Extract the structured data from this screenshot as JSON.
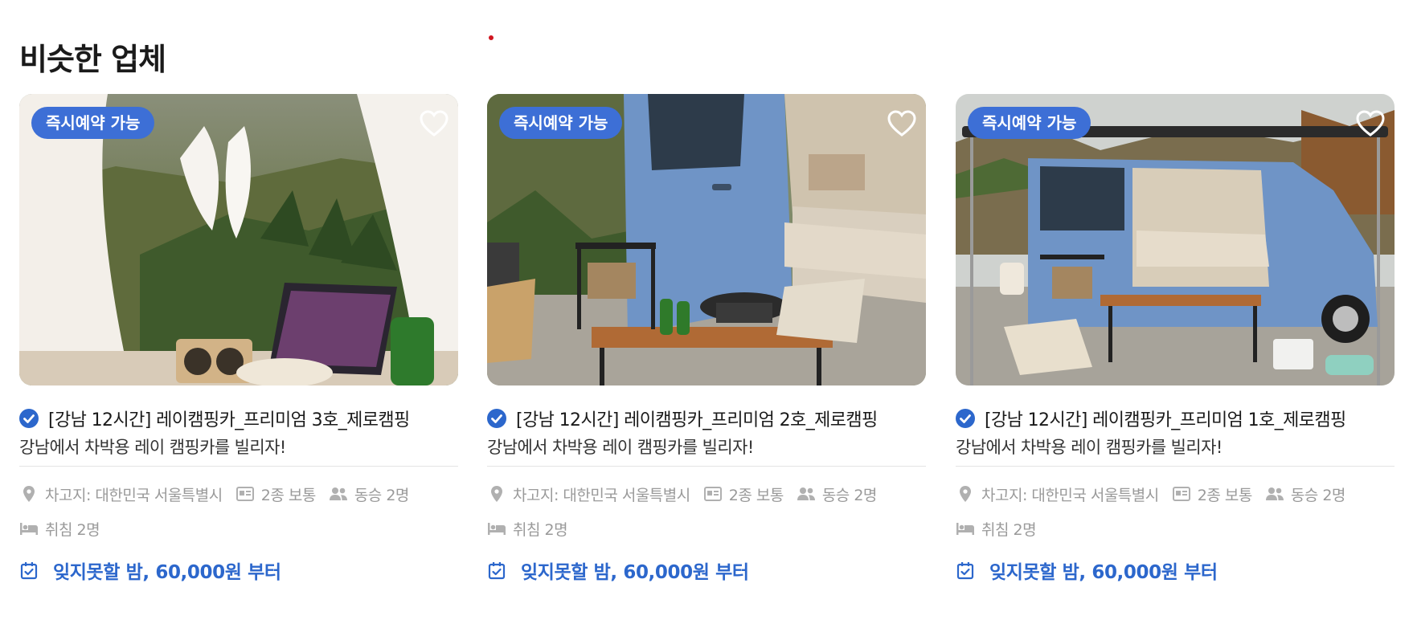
{
  "section": {
    "title": "비슷한 업체"
  },
  "cards": [
    {
      "badge": "즉시예약 가능",
      "name": "[강남 12시간] 레이캠핑카_프리미엄 3호_제로캠핑",
      "subtitle": "강남에서 차박용 레이 캠핑카를 빌리자!",
      "location": "차고지: 대한민국 서울특별시",
      "license": "2종 보통",
      "passengers": "동승 2명",
      "sleeping": "취침 2명",
      "price": "잊지못할 밤, 60,000원 부터"
    },
    {
      "badge": "즉시예약 가능",
      "name": "[강남 12시간] 레이캠핑카_프리미엄 2호_제로캠핑",
      "subtitle": "강남에서 차박용 레이 캠핑카를 빌리자!",
      "location": "차고지: 대한민국 서울특별시",
      "license": "2종 보통",
      "passengers": "동승 2명",
      "sleeping": "취침 2명",
      "price": "잊지못할 밤, 60,000원 부터"
    },
    {
      "badge": "즉시예약 가능",
      "name": "[강남 12시간] 레이캠핑카_프리미엄 1호_제로캠핑",
      "subtitle": "강남에서 차박용 레이 캠핑카를 빌리자!",
      "location": "차고지: 대한민국 서울특별시",
      "license": "2종 보통",
      "passengers": "동승 2명",
      "sleeping": "취침 2명",
      "price": "잊지못할 밤, 60,000원 부터"
    }
  ],
  "colors": {
    "accent": "#2c67cc",
    "badge_bg": "#3d6fd6",
    "meta_text": "#9a9a9a",
    "marker_red": "#d0151f"
  },
  "icons": {
    "favorite": "heart-outline-icon",
    "verified": "check-circle-icon",
    "location": "map-pin-icon",
    "license": "id-card-icon",
    "passengers": "people-icon",
    "sleeping": "bed-icon",
    "price": "calendar-check-icon"
  }
}
